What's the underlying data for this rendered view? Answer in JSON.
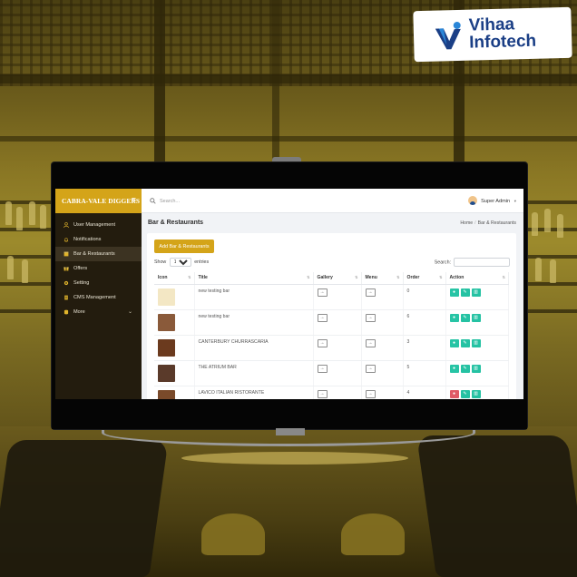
{
  "logo": {
    "line1": "Vihaa",
    "line2": "Infotech"
  },
  "sidebar": {
    "brand": "CABRA-VALE DIGGERS",
    "menu_icon": "hamburger-icon",
    "items": [
      {
        "label": "User Management",
        "icon": "user-icon",
        "active": false
      },
      {
        "label": "Notifications",
        "icon": "bell-icon",
        "active": false
      },
      {
        "label": "Bar & Restaurants",
        "icon": "store-icon",
        "active": true
      },
      {
        "label": "Offers",
        "icon": "gift-icon",
        "active": false
      },
      {
        "label": "Setting",
        "icon": "gear-icon",
        "active": false
      },
      {
        "label": "CMS Management",
        "icon": "document-icon",
        "active": false
      },
      {
        "label": "More",
        "icon": "database-icon",
        "active": false
      }
    ]
  },
  "topbar": {
    "search_placeholder": "Search...",
    "user_name": "Super Admin",
    "dropdown_caret": "▾"
  },
  "page": {
    "title": "Bar & Restaurants",
    "breadcrumb": [
      "Home",
      "Bar & Restaurants"
    ]
  },
  "table_controls": {
    "add_button": "Add Bar & Restaurants",
    "show_label": "Show",
    "entries_value": "10",
    "entries_label": "entries",
    "search_label": "Search:"
  },
  "table": {
    "columns": [
      "Icon",
      "Title",
      "Gallery",
      "Menu",
      "Order",
      "Action"
    ],
    "rows": [
      {
        "title": "new testing bar",
        "order": "0",
        "thumb": "#f3e7c4",
        "visible": true
      },
      {
        "title": "new testing bar",
        "order": "6",
        "thumb": "#8a5a3a",
        "visible": true
      },
      {
        "title": "CANTERBURY CHURRASCARIA",
        "order": "3",
        "thumb": "#6b3a1e",
        "visible": true
      },
      {
        "title": "THE ATRIUM BAR",
        "order": "5",
        "thumb": "#5a3a2a",
        "visible": true
      },
      {
        "title": "LAVICO ITALIAN RISTORANTE",
        "order": "4",
        "thumb": "#7a4a2a",
        "visible": false
      }
    ],
    "gallery_button": "→",
    "menu_button": "→"
  },
  "colors": {
    "accent": "#d4a419",
    "sidebar": "#231c0e",
    "action": "#25c2a3",
    "logo_text": "#1b3f86"
  }
}
